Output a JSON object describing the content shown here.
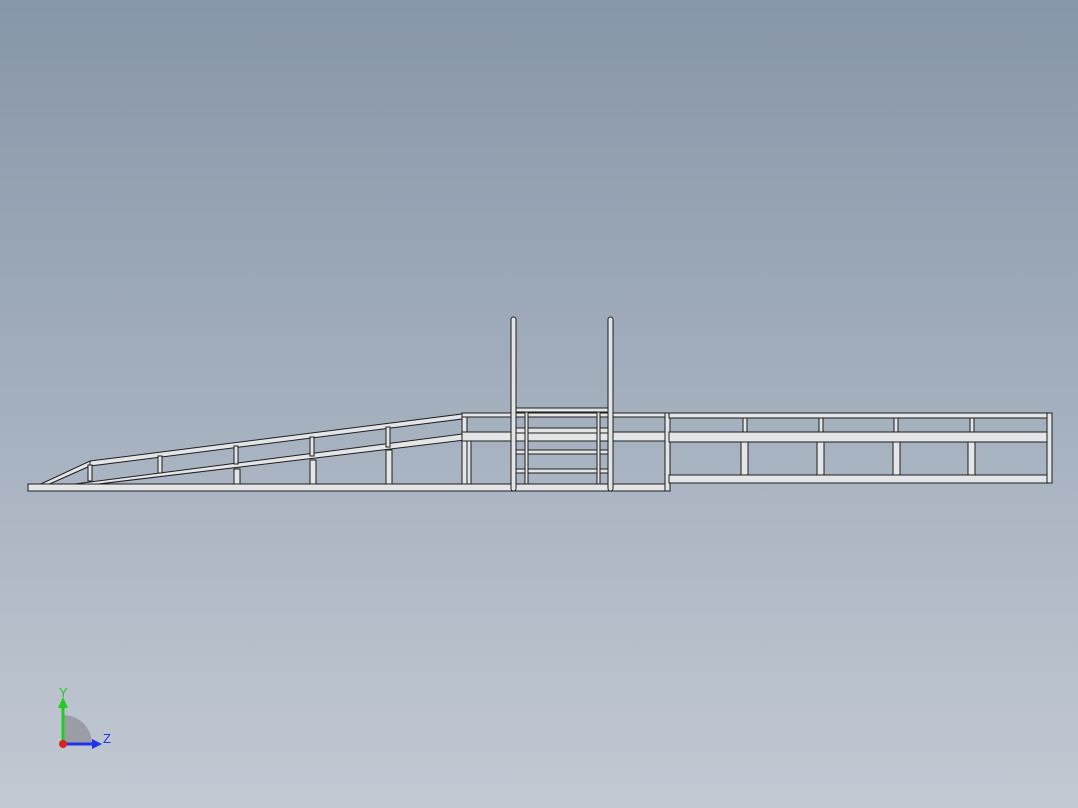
{
  "viewport": {
    "background_top": "#8796a8",
    "background_bottom": "#c3c9d3"
  },
  "model": {
    "description_icon": "ramp-platform-frame-icon",
    "frame_fill": "#e2e4e6",
    "frame_stroke": "#1e1e1e"
  },
  "triad": {
    "y_label": "Y",
    "z_label": "Z",
    "y_color": "#22cc22",
    "z_color": "#2233ee",
    "x_color": "#dd2222"
  }
}
